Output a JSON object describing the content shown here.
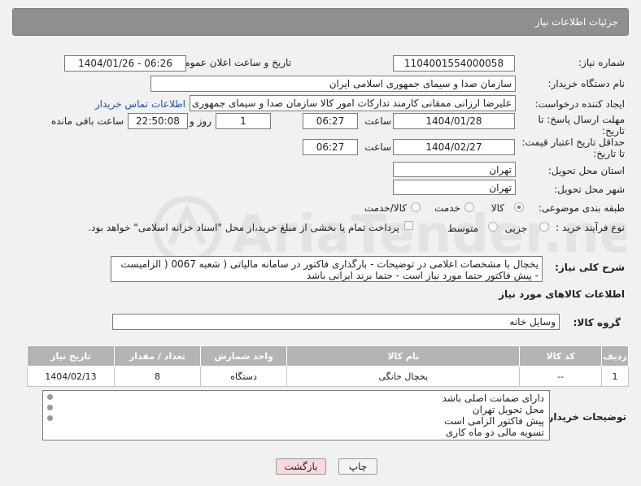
{
  "header": {
    "title": "جزئیات اطلاعات نیاز"
  },
  "fields": {
    "need_number_label": "شماره نیاز:",
    "need_number": "1104001554000058",
    "announce_label": "تاریخ و ساعت اعلان عمومی:",
    "announce_value": "1404/01/26 - 06:26",
    "buyer_org_label": "نام دستگاه خریدار:",
    "buyer_org": "سازمان صدا و سیمای جمهوری اسلامی ایران",
    "creator_label": "ایجاد کننده درخواست:",
    "creator": "علیرضا ارزانی ممقانی کارمند تدارکات امور کالا سازمان صدا و سیمای جمهوری اسلامی ایران",
    "contact_link": "اطلاعات تماس خریدار",
    "deadline_label_1": "مهلت ارسال پاسخ: تا",
    "deadline_label_2": "تاریخ:",
    "deadline_date": "1404/01/28",
    "time_label": "ساعت",
    "deadline_time": "06:27",
    "days_value": "1",
    "days_label": "روز و",
    "remaining_time": "22:50:08",
    "remaining_label": "ساعت باقی مانده",
    "min_price_label_1": "حداقل تاریخ اعتبار قیمت:",
    "min_price_label_2": "تا تاریخ:",
    "min_price_date": "1404/02/27",
    "min_price_time": "06:27",
    "province_label": "استان محل تحویل:",
    "province": "تهران",
    "city_label": "شهر محل تحویل:",
    "city": "تهران",
    "category_label": "طبقه بندی موضوعی:",
    "category_options": [
      "کالا",
      "خدمت",
      "کالا/خدمت"
    ],
    "process_label": "نوع فرآیند خرید :",
    "process_options": [
      "جزیی",
      "متوسط"
    ],
    "payment_note": "پرداخت تمام یا بخشی از مبلغ خرید،از محل \"اسناد خزانه اسلامی\" خواهد بود.",
    "summary_label": "شرح کلی نیاز:",
    "summary": "یخچال با مشخصات اعلامی در توضیحات - بارگذاری فاکتور در سامانه مالیاتی ( شعبه 0067 ( الزامیست - پیش فاکتور حتما مورد نیاز است - حتما برند ایرانی باشد",
    "goods_info_title": "اطلاعات کالاهای مورد نیاز",
    "goods_group_label": "گروه کالا:",
    "goods_group": "وسایل خانه"
  },
  "table": {
    "headers": [
      "ردیف",
      "کد کالا",
      "نام کالا",
      "واحد شمارش",
      "تعداد / مقدار",
      "تاریخ نیاز"
    ],
    "rows": [
      [
        "1",
        "--",
        "یخچال خانگی",
        "دستگاه",
        "8",
        "1404/02/13"
      ]
    ]
  },
  "buyer_notes": {
    "label": "توضیحات خریدار:",
    "lines": [
      "دارای ضمانت اصلی باشد",
      "محل تحویل تهران",
      "پیش فاکتور الزامی است",
      "تسویه مالی دو ماه کاری"
    ]
  },
  "buttons": {
    "print": "چاپ",
    "back": "بازگشت"
  },
  "watermark": {
    "text": "AriaTender.neT"
  },
  "colors": {
    "header_bg": "#8f8f8f",
    "link": "#1a55b0",
    "back_btn_bg": "#f9d9dc"
  }
}
